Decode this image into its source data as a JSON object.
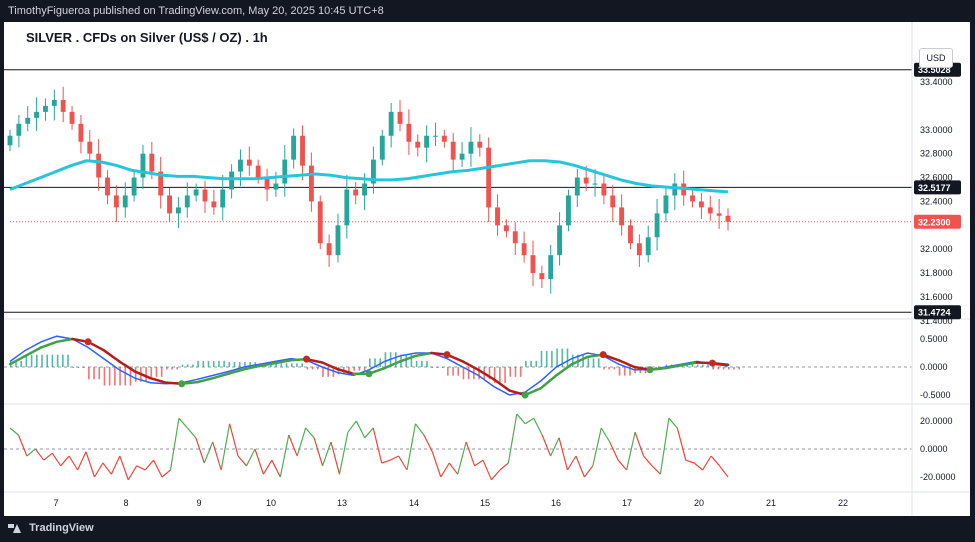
{
  "header": {
    "publisher_text": "TimothyFigueroa published on TradingView.com, May 20, 2025 10:45 UTC+8"
  },
  "footer": {
    "brand": "TradingView"
  },
  "chart_data": [
    {
      "type": "candlestick",
      "title": "SILVER . CFDs on Silver (US$ / OZ) . 1h",
      "currency": "USD",
      "x_tick_labels": [
        "7",
        "8",
        "9",
        "10",
        "13",
        "14",
        "15",
        "16",
        "17",
        "20",
        "21",
        "22"
      ],
      "y_tick_labels": [
        "33.4000",
        "33.0000",
        "32.6000",
        "32.4000",
        "32.8000",
        "32.2000",
        "32.0000",
        "31.8000",
        "31.6000",
        "31.4000"
      ],
      "ylim": [
        31.4,
        33.6
      ],
      "horizontal_levels": [
        33.5028,
        32.5177,
        31.4724
      ],
      "last_price": 32.23,
      "price_tags": [
        "33.5028",
        "32.5177",
        "32.2300",
        "31.4724"
      ],
      "moving_average_color": "#26c6da",
      "close_series": [
        32.95,
        33.05,
        33.1,
        33.15,
        33.2,
        33.25,
        33.15,
        33.05,
        32.9,
        32.8,
        32.6,
        32.45,
        32.35,
        32.45,
        32.6,
        32.8,
        32.65,
        32.45,
        32.3,
        32.35,
        32.45,
        32.5,
        32.4,
        32.35,
        32.5,
        32.65,
        32.75,
        32.7,
        32.6,
        32.5,
        32.55,
        32.75,
        32.95,
        32.7,
        32.4,
        32.05,
        31.95,
        32.2,
        32.5,
        32.45,
        32.55,
        32.75,
        32.95,
        33.15,
        33.05,
        32.9,
        32.85,
        32.95,
        32.95,
        32.9,
        32.75,
        32.8,
        32.9,
        32.85,
        32.35,
        32.2,
        32.15,
        32.05,
        31.95,
        31.8,
        31.75,
        31.95,
        32.2,
        32.45,
        32.6,
        32.55,
        32.55,
        32.45,
        32.35,
        32.2,
        32.05,
        31.95,
        32.1,
        32.3,
        32.45,
        32.55,
        32.45,
        32.4,
        32.35,
        32.3,
        32.28,
        32.23
      ],
      "ma_series": [
        32.5,
        32.55,
        32.6,
        32.65,
        32.7,
        32.74,
        32.73,
        32.7,
        32.66,
        32.64,
        32.62,
        32.61,
        32.61,
        32.6,
        32.59,
        32.59,
        32.59,
        32.6,
        32.61,
        32.62,
        32.63,
        32.62,
        32.6,
        32.59,
        32.58,
        32.58,
        32.59,
        32.61,
        32.63,
        32.65,
        32.66,
        32.68,
        32.7,
        32.72,
        32.74,
        32.74,
        32.73,
        32.7,
        32.66,
        32.62,
        32.58,
        32.55,
        32.53,
        32.52,
        32.51,
        32.5,
        32.49,
        32.48
      ]
    },
    {
      "type": "line",
      "name": "MACD",
      "y_tick_labels": [
        "0.5000",
        "0.0000",
        "-0.5000"
      ],
      "ylim": [
        -0.75,
        0.75
      ],
      "macd": [
        0.1,
        0.3,
        0.45,
        0.55,
        0.5,
        0.35,
        0.15,
        -0.05,
        -0.2,
        -0.28,
        -0.3,
        -0.28,
        -0.22,
        -0.15,
        -0.08,
        0.0,
        0.05,
        0.1,
        0.15,
        0.12,
        0.0,
        -0.1,
        -0.15,
        -0.05,
        0.1,
        0.2,
        0.25,
        0.25,
        0.15,
        0.0,
        -0.15,
        -0.35,
        -0.5,
        -0.45,
        -0.25,
        0.0,
        0.15,
        0.25,
        0.2,
        0.05,
        -0.05,
        -0.05,
        0.0,
        0.05,
        0.1,
        0.05,
        0.02
      ],
      "signal": [
        0.05,
        0.2,
        0.35,
        0.45,
        0.5,
        0.45,
        0.3,
        0.1,
        -0.08,
        -0.2,
        -0.28,
        -0.3,
        -0.27,
        -0.2,
        -0.12,
        -0.04,
        0.02,
        0.07,
        0.12,
        0.14,
        0.08,
        -0.04,
        -0.12,
        -0.12,
        -0.02,
        0.1,
        0.2,
        0.25,
        0.22,
        0.1,
        -0.05,
        -0.22,
        -0.42,
        -0.5,
        -0.38,
        -0.15,
        0.05,
        0.18,
        0.22,
        0.12,
        0.0,
        -0.05,
        -0.02,
        0.03,
        0.08,
        0.07,
        0.04
      ],
      "histogram_colors": {
        "positive": "#26a69a",
        "negative": "#ef5350"
      },
      "line_colors": {
        "macd": "#2962ff",
        "signal_up": "#43a047",
        "signal_down": "#b71c1c"
      }
    },
    {
      "type": "line",
      "name": "Oscillator",
      "y_tick_labels": [
        "20.0000",
        "0.0000",
        "-20.0000"
      ],
      "ylim": [
        -28,
        28
      ],
      "values": [
        15,
        10,
        -5,
        0,
        -8,
        -3,
        -12,
        -5,
        -15,
        -2,
        -20,
        -10,
        -18,
        -5,
        -22,
        -12,
        -15,
        -8,
        -20,
        -15,
        22,
        15,
        8,
        -10,
        5,
        -15,
        18,
        -5,
        -12,
        0,
        -18,
        -8,
        -20,
        10,
        -5,
        15,
        8,
        -12,
        5,
        -18,
        12,
        20,
        8,
        15,
        -10,
        -8,
        -5,
        -15,
        18,
        10,
        -2,
        -20,
        -10,
        -18,
        5,
        -12,
        -8,
        -22,
        -15,
        -10,
        25,
        18,
        22,
        10,
        -5,
        8,
        -15,
        -5,
        -20,
        -12,
        15,
        5,
        -8,
        -15,
        12,
        -5,
        -12,
        -18,
        22,
        15,
        -8,
        -10,
        -15,
        -5,
        -12,
        -20
      ],
      "line_colors": {
        "up": "#4caf50",
        "down": "#f44336"
      }
    }
  ]
}
